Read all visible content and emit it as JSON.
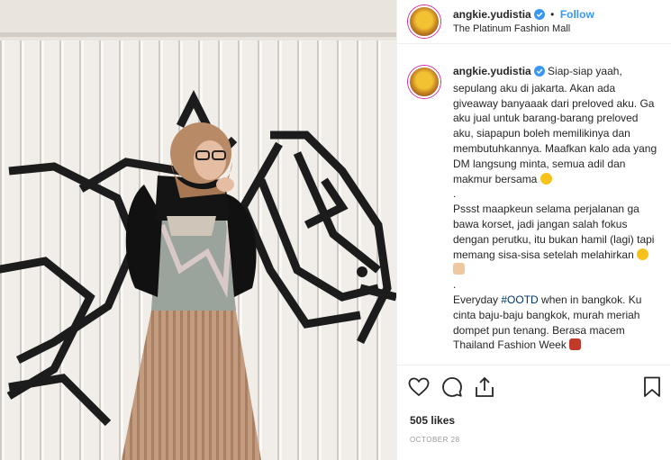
{
  "header": {
    "username": "angkie.yudistia",
    "follow_label": "Follow",
    "separator": "•",
    "location": "The Platinum Fashion Mall"
  },
  "caption": {
    "username": "angkie.yudistia",
    "paragraph1": "Siap-siap yaah, sepulang aku di jakarta. Akan ada giveaway banyaaak dari preloved aku. Ga aku jual untuk barang-barang preloved aku, siapapun boleh memilikinya dan membutuhkannya. Maafkan kalo ada yang DM langsung minta, semua adil dan makmur bersama",
    "dot1": ".",
    "paragraph2": "Pssst maapkeun selama perjalanan ga bawa korset, jadi jangan salah fokus dengan perutku, itu bukan hamil (lagi) tapi memang sisa-sisa setelah melahirkan",
    "dot2": ".",
    "paragraph3_before": "Everyday ",
    "hashtag": "#OOTD",
    "paragraph3_after": " when in bangkok. Ku cinta baju-baju bangkok, murah meriah dompet pun tenang. Berasa macem Thailand Fashion Week"
  },
  "stats": {
    "likes": "505 likes",
    "date": "OCTOBER 28"
  },
  "icons": {
    "like": "heart-icon",
    "comment": "comment-icon",
    "share": "share-icon",
    "save": "bookmark-icon",
    "verified": "verified-badge-icon"
  },
  "colors": {
    "link": "#3897f0",
    "text": "#262626",
    "muted": "#999999",
    "border": "#efefef"
  }
}
